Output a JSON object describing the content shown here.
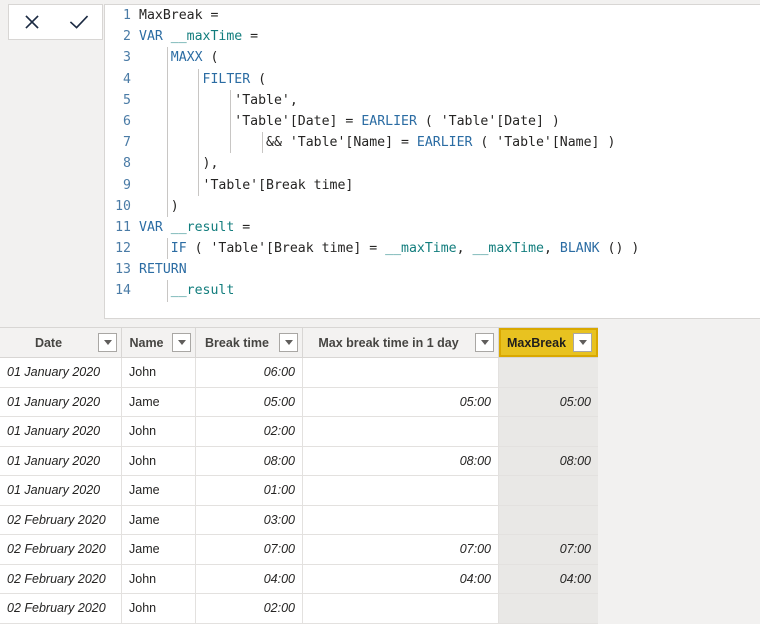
{
  "toolbar": {
    "cancel_label": "Cancel",
    "cancel_icon": "close-icon",
    "accept_label": "Accept",
    "accept_icon": "check-icon"
  },
  "formula": {
    "lines": [
      {
        "n": "1",
        "tokens": [
          {
            "t": "MaxBreak =",
            "c": "plain"
          }
        ]
      },
      {
        "n": "2",
        "tokens": [
          {
            "t": "VAR ",
            "c": "kw"
          },
          {
            "t": "__maxTime",
            "c": "varname"
          },
          {
            "t": " =",
            "c": "plain"
          }
        ]
      },
      {
        "n": "3",
        "tokens": [
          {
            "t": "    ",
            "c": "plain"
          },
          {
            "t": "MAXX",
            "c": "fn"
          },
          {
            "t": " (",
            "c": "plain"
          }
        ]
      },
      {
        "n": "4",
        "tokens": [
          {
            "t": "        ",
            "c": "plain"
          },
          {
            "t": "FILTER",
            "c": "fn"
          },
          {
            "t": " (",
            "c": "plain"
          }
        ]
      },
      {
        "n": "5",
        "tokens": [
          {
            "t": "            'Table',",
            "c": "plain"
          }
        ]
      },
      {
        "n": "6",
        "tokens": [
          {
            "t": "            'Table'[Date] = ",
            "c": "plain"
          },
          {
            "t": "EARLIER",
            "c": "fn"
          },
          {
            "t": " ( 'Table'[Date] )",
            "c": "plain"
          }
        ]
      },
      {
        "n": "7",
        "tokens": [
          {
            "t": "                && 'Table'[Name] = ",
            "c": "plain"
          },
          {
            "t": "EARLIER",
            "c": "fn"
          },
          {
            "t": " ( 'Table'[Name] )",
            "c": "plain"
          }
        ]
      },
      {
        "n": "8",
        "tokens": [
          {
            "t": "        ),",
            "c": "plain"
          }
        ]
      },
      {
        "n": "9",
        "tokens": [
          {
            "t": "        'Table'[Break time]",
            "c": "plain"
          }
        ]
      },
      {
        "n": "10",
        "tokens": [
          {
            "t": "    )",
            "c": "plain"
          }
        ]
      },
      {
        "n": "11",
        "tokens": [
          {
            "t": "VAR ",
            "c": "kw"
          },
          {
            "t": "__result",
            "c": "varname"
          },
          {
            "t": " =",
            "c": "plain"
          }
        ]
      },
      {
        "n": "12",
        "tokens": [
          {
            "t": "    ",
            "c": "plain"
          },
          {
            "t": "IF",
            "c": "fn"
          },
          {
            "t": " ( 'Table'[Break time] = ",
            "c": "plain"
          },
          {
            "t": "__maxTime",
            "c": "varname"
          },
          {
            "t": ", ",
            "c": "plain"
          },
          {
            "t": "__maxTime",
            "c": "varname"
          },
          {
            "t": ", ",
            "c": "plain"
          },
          {
            "t": "BLANK",
            "c": "fn"
          },
          {
            "t": " () )",
            "c": "plain"
          }
        ]
      },
      {
        "n": "13",
        "tokens": [
          {
            "t": "RETURN",
            "c": "kw"
          }
        ]
      },
      {
        "n": "14",
        "tokens": [
          {
            "t": "    ",
            "c": "plain"
          },
          {
            "t": "__result",
            "c": "varname"
          }
        ]
      }
    ],
    "guides": [
      {
        "line": 2,
        "cols": []
      },
      {
        "line": 3,
        "cols": [
          0
        ]
      },
      {
        "line": 4,
        "cols": [
          0,
          1
        ]
      },
      {
        "line": 5,
        "cols": [
          0,
          1,
          2
        ]
      },
      {
        "line": 6,
        "cols": [
          0,
          1,
          2
        ]
      },
      {
        "line": 7,
        "cols": [
          0,
          1,
          2,
          3
        ]
      },
      {
        "line": 8,
        "cols": [
          0,
          1
        ]
      },
      {
        "line": 9,
        "cols": [
          0,
          1
        ]
      },
      {
        "line": 10,
        "cols": [
          0
        ]
      },
      {
        "line": 12,
        "cols": [
          0
        ]
      },
      {
        "line": 14,
        "cols": [
          0
        ]
      }
    ]
  },
  "table": {
    "columns": [
      {
        "key": "date",
        "label": "Date",
        "highlight": false,
        "align": "left"
      },
      {
        "key": "name",
        "label": "Name",
        "highlight": false,
        "align": "left"
      },
      {
        "key": "break",
        "label": "Break time",
        "highlight": false,
        "align": "right"
      },
      {
        "key": "max",
        "label": "Max break time in 1 day",
        "highlight": false,
        "align": "right"
      },
      {
        "key": "mb",
        "label": "MaxBreak",
        "highlight": true,
        "align": "right"
      }
    ],
    "highlight_color": "#e8c220",
    "rows": [
      {
        "date": "01 January 2020",
        "name": "John",
        "break": "06:00",
        "max": "",
        "mb": ""
      },
      {
        "date": "01 January 2020",
        "name": "Jame",
        "break": "05:00",
        "max": "05:00",
        "mb": "05:00"
      },
      {
        "date": "01 January 2020",
        "name": "John",
        "break": "02:00",
        "max": "",
        "mb": ""
      },
      {
        "date": "01 January 2020",
        "name": "John",
        "break": "08:00",
        "max": "08:00",
        "mb": "08:00"
      },
      {
        "date": "01 January 2020",
        "name": "Jame",
        "break": "01:00",
        "max": "",
        "mb": ""
      },
      {
        "date": "02 February 2020",
        "name": "Jame",
        "break": "03:00",
        "max": "",
        "mb": ""
      },
      {
        "date": "02 February 2020",
        "name": "Jame",
        "break": "07:00",
        "max": "07:00",
        "mb": "07:00"
      },
      {
        "date": "02 February 2020",
        "name": "John",
        "break": "04:00",
        "max": "04:00",
        "mb": "04:00"
      },
      {
        "date": "02 February 2020",
        "name": "John",
        "break": "02:00",
        "max": "",
        "mb": ""
      }
    ]
  }
}
